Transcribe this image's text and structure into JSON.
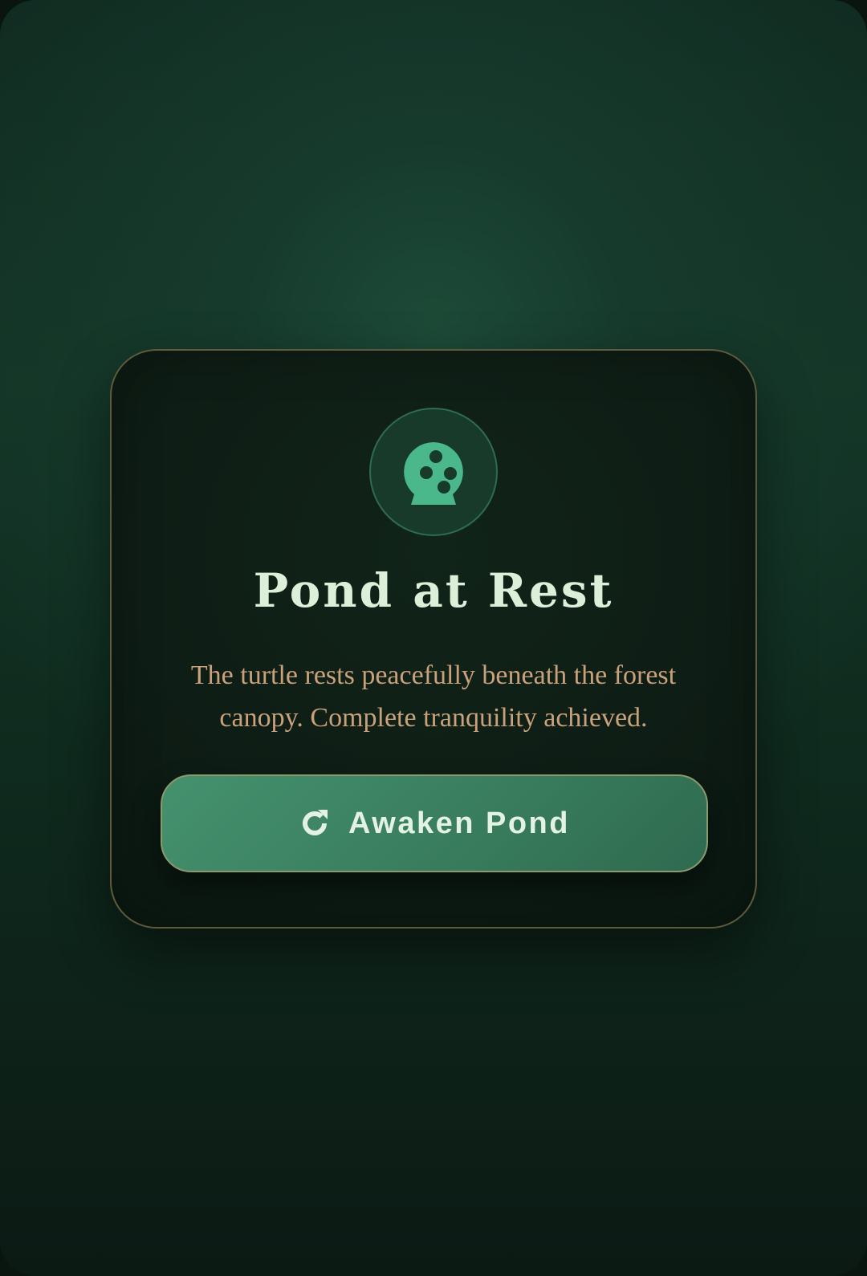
{
  "card": {
    "icon": "turtle-shell-icon",
    "title": "Pond at Rest",
    "description": "The turtle rests peacefully beneath the forest canopy. Complete tranquility achieved.",
    "button": {
      "icon": "refresh-icon",
      "label": "Awaken Pond"
    }
  },
  "colors": {
    "accent": "#3f8a68",
    "title": "#dcefd9",
    "description": "#c9a27c",
    "border": "#5e5a3c"
  }
}
